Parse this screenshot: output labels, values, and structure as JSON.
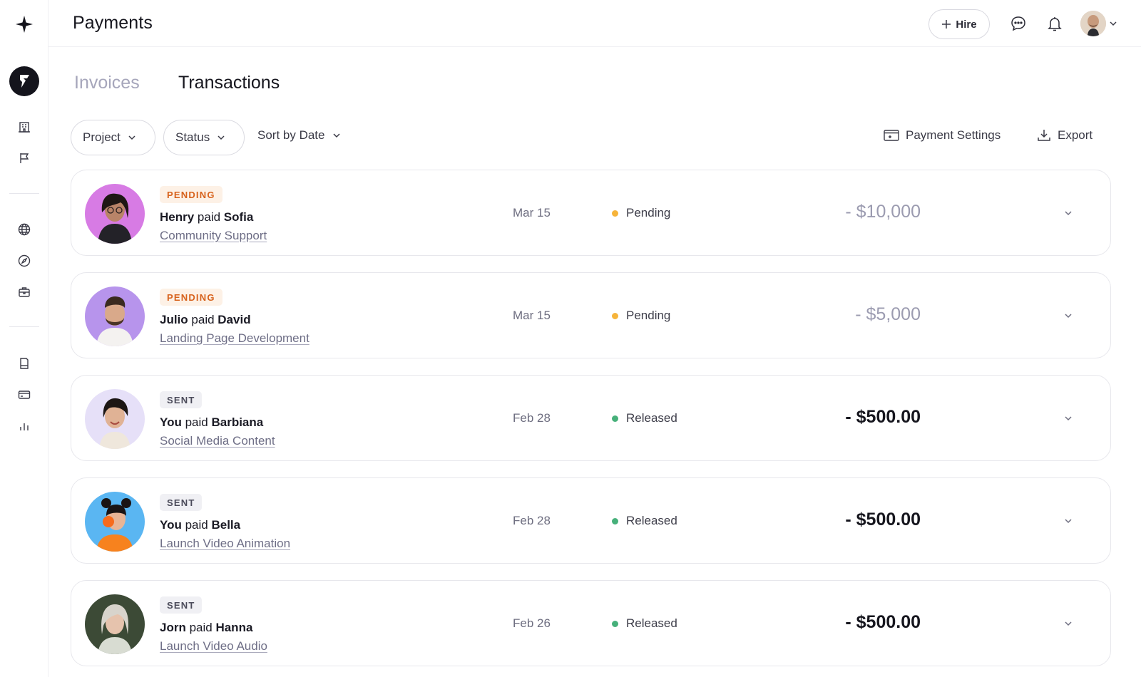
{
  "header": {
    "title": "Payments",
    "hire_label": "Hire"
  },
  "tabs": [
    {
      "label": "Invoices",
      "active": false
    },
    {
      "label": "Transactions",
      "active": true
    }
  ],
  "filters": {
    "project_label": "Project",
    "status_label": "Status",
    "sort_label": "Sort by Date",
    "payment_settings_label": "Payment Settings",
    "export_label": "Export"
  },
  "sidebar": {
    "icons": [
      "spark-logo-icon",
      "brand-icon",
      "building-icon",
      "flag-icon",
      "globe-icon",
      "compass-icon",
      "briefcase-icon",
      "document-icon",
      "card-icon",
      "bar-chart-icon"
    ]
  },
  "transactions": [
    {
      "badge": "PENDING",
      "payer": "Henry",
      "verb": "paid",
      "payee": "Sofia",
      "project": "Community Support",
      "date": "Mar 15",
      "status": "Pending",
      "amount": "- $10,000",
      "avatar_color": "#d77be4"
    },
    {
      "badge": "PENDING",
      "payer": "Julio",
      "verb": "paid",
      "payee": "David",
      "project": "Landing Page Development",
      "date": "Mar 15",
      "status": "Pending",
      "amount": "- $5,000",
      "avatar_color": "#b794ec"
    },
    {
      "badge": "SENT",
      "payer": "You",
      "verb": "paid",
      "payee": "Barbiana",
      "project": "Social Media Content",
      "date": "Feb 28",
      "status": "Released",
      "amount": "- $500.00",
      "avatar_color": "#e6e0f8"
    },
    {
      "badge": "SENT",
      "payer": "You",
      "verb": "paid",
      "payee": "Bella",
      "project": "Launch Video Animation",
      "date": "Feb 28",
      "status": "Released",
      "amount": "- $500.00",
      "avatar_color": "#5ab6f2"
    },
    {
      "badge": "SENT",
      "payer": "Jorn",
      "verb": "paid",
      "payee": "Hanna",
      "project": "Launch Video Audio",
      "date": "Feb 26",
      "status": "Released",
      "amount": "- $500.00",
      "avatar_color": "#3c4a36"
    }
  ],
  "colors": {
    "pending_badge_text": "#d7621c",
    "pending_dot": "#f6b43a",
    "released_dot": "#46b07a",
    "tab_inactive": "#a6a6bb"
  }
}
